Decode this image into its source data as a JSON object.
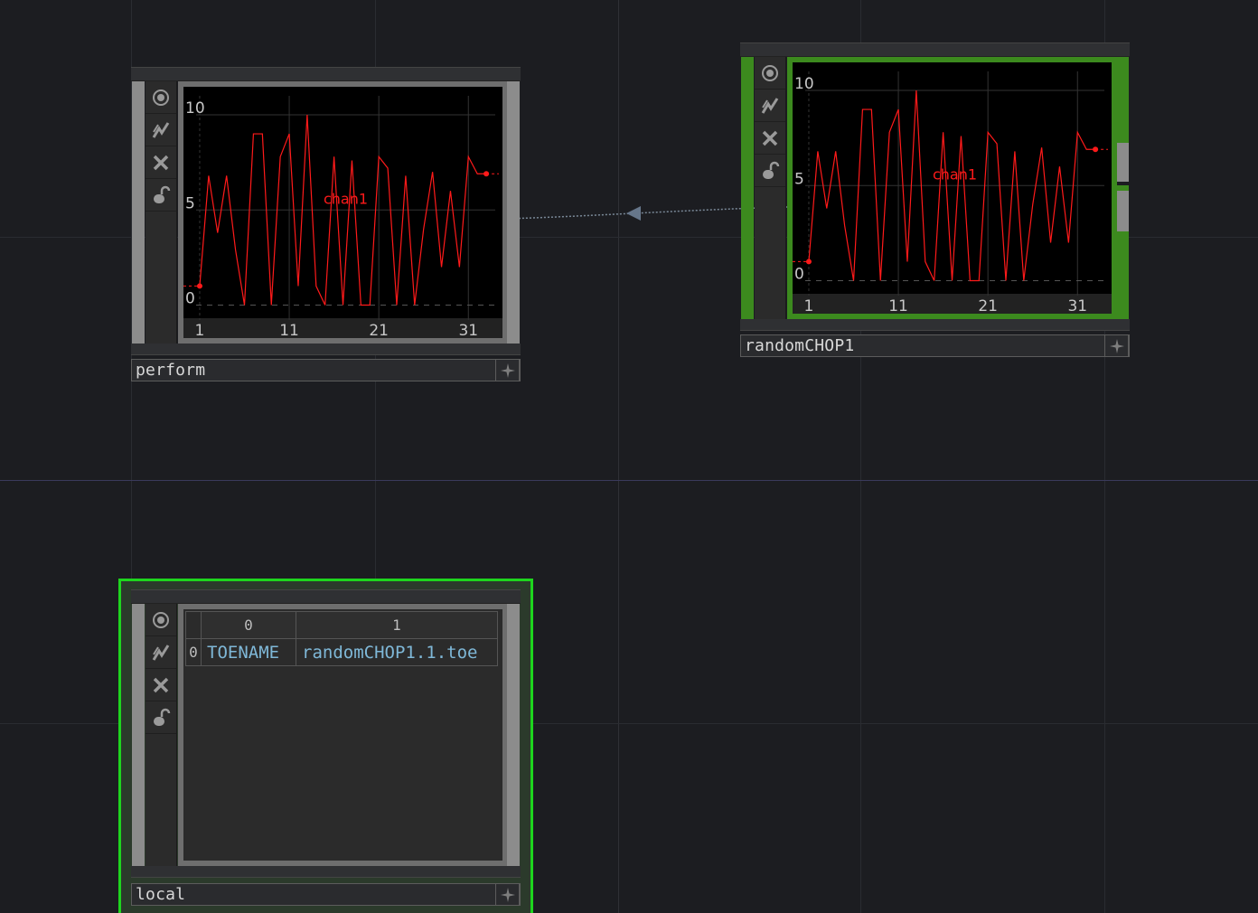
{
  "colors": {
    "background": "#1c1d21",
    "selected_node_frame": "#1ed51e",
    "active_node_body": "#3c8a1e",
    "chart_line": "#ff1a1a",
    "table_text": "#7fb8d8"
  },
  "node_icons": [
    "viewer-active-icon",
    "bypass-icon",
    "delete-icon",
    "lock-icon"
  ],
  "nodes": {
    "perform": {
      "name": "perform",
      "chart_data": {
        "type": "line",
        "series": [
          {
            "name": "chan1",
            "values": [
              1.0,
              6.8,
              3.8,
              6.8,
              2.9,
              0.0,
              9.0,
              9.0,
              0.0,
              7.8,
              9.0,
              1.0,
              10.0,
              1.0,
              0.0,
              7.8,
              0.0,
              7.6,
              0.0,
              0.0,
              7.8,
              7.2,
              0.0,
              6.8,
              0.0,
              4.0,
              7.0,
              2.0,
              6.0,
              2.0,
              7.8,
              6.9,
              6.9
            ]
          }
        ],
        "x": [
          1,
          2,
          3,
          4,
          5,
          6,
          7,
          8,
          9,
          10,
          11,
          12,
          13,
          14,
          15,
          16,
          17,
          18,
          19,
          20,
          21,
          22,
          23,
          24,
          25,
          26,
          27,
          28,
          29,
          30,
          31,
          32,
          33
        ],
        "x_ticks": [
          "1",
          "11",
          "21",
          "31"
        ],
        "y_ticks": [
          "0",
          "5",
          "10"
        ],
        "ylim": [
          -0.5,
          11
        ],
        "xlim": [
          0.6,
          34
        ]
      }
    },
    "random": {
      "name": "randomCHOP1",
      "chart_data": {
        "type": "line",
        "series": [
          {
            "name": "chan1",
            "values": [
              1.0,
              6.8,
              3.8,
              6.8,
              2.9,
              0.0,
              9.0,
              9.0,
              0.0,
              7.8,
              9.0,
              1.0,
              10.0,
              1.0,
              0.0,
              7.8,
              0.0,
              7.6,
              0.0,
              0.0,
              7.8,
              7.2,
              0.0,
              6.8,
              0.0,
              4.0,
              7.0,
              2.0,
              6.0,
              2.0,
              7.8,
              6.9,
              6.9
            ]
          }
        ],
        "x": [
          1,
          2,
          3,
          4,
          5,
          6,
          7,
          8,
          9,
          10,
          11,
          12,
          13,
          14,
          15,
          16,
          17,
          18,
          19,
          20,
          21,
          22,
          23,
          24,
          25,
          26,
          27,
          28,
          29,
          30,
          31,
          32,
          33
        ],
        "x_ticks": [
          "1",
          "11",
          "21",
          "31"
        ],
        "y_ticks": [
          "0",
          "5",
          "10"
        ],
        "ylim": [
          -0.5,
          11
        ],
        "xlim": [
          0.6,
          34
        ]
      }
    },
    "local": {
      "name": "local",
      "table": {
        "col_headers": [
          "0",
          "1"
        ],
        "rows": [
          {
            "index": "0",
            "cells": [
              "TOENAME",
              "randomCHOP1.1.toe"
            ]
          }
        ]
      }
    }
  }
}
